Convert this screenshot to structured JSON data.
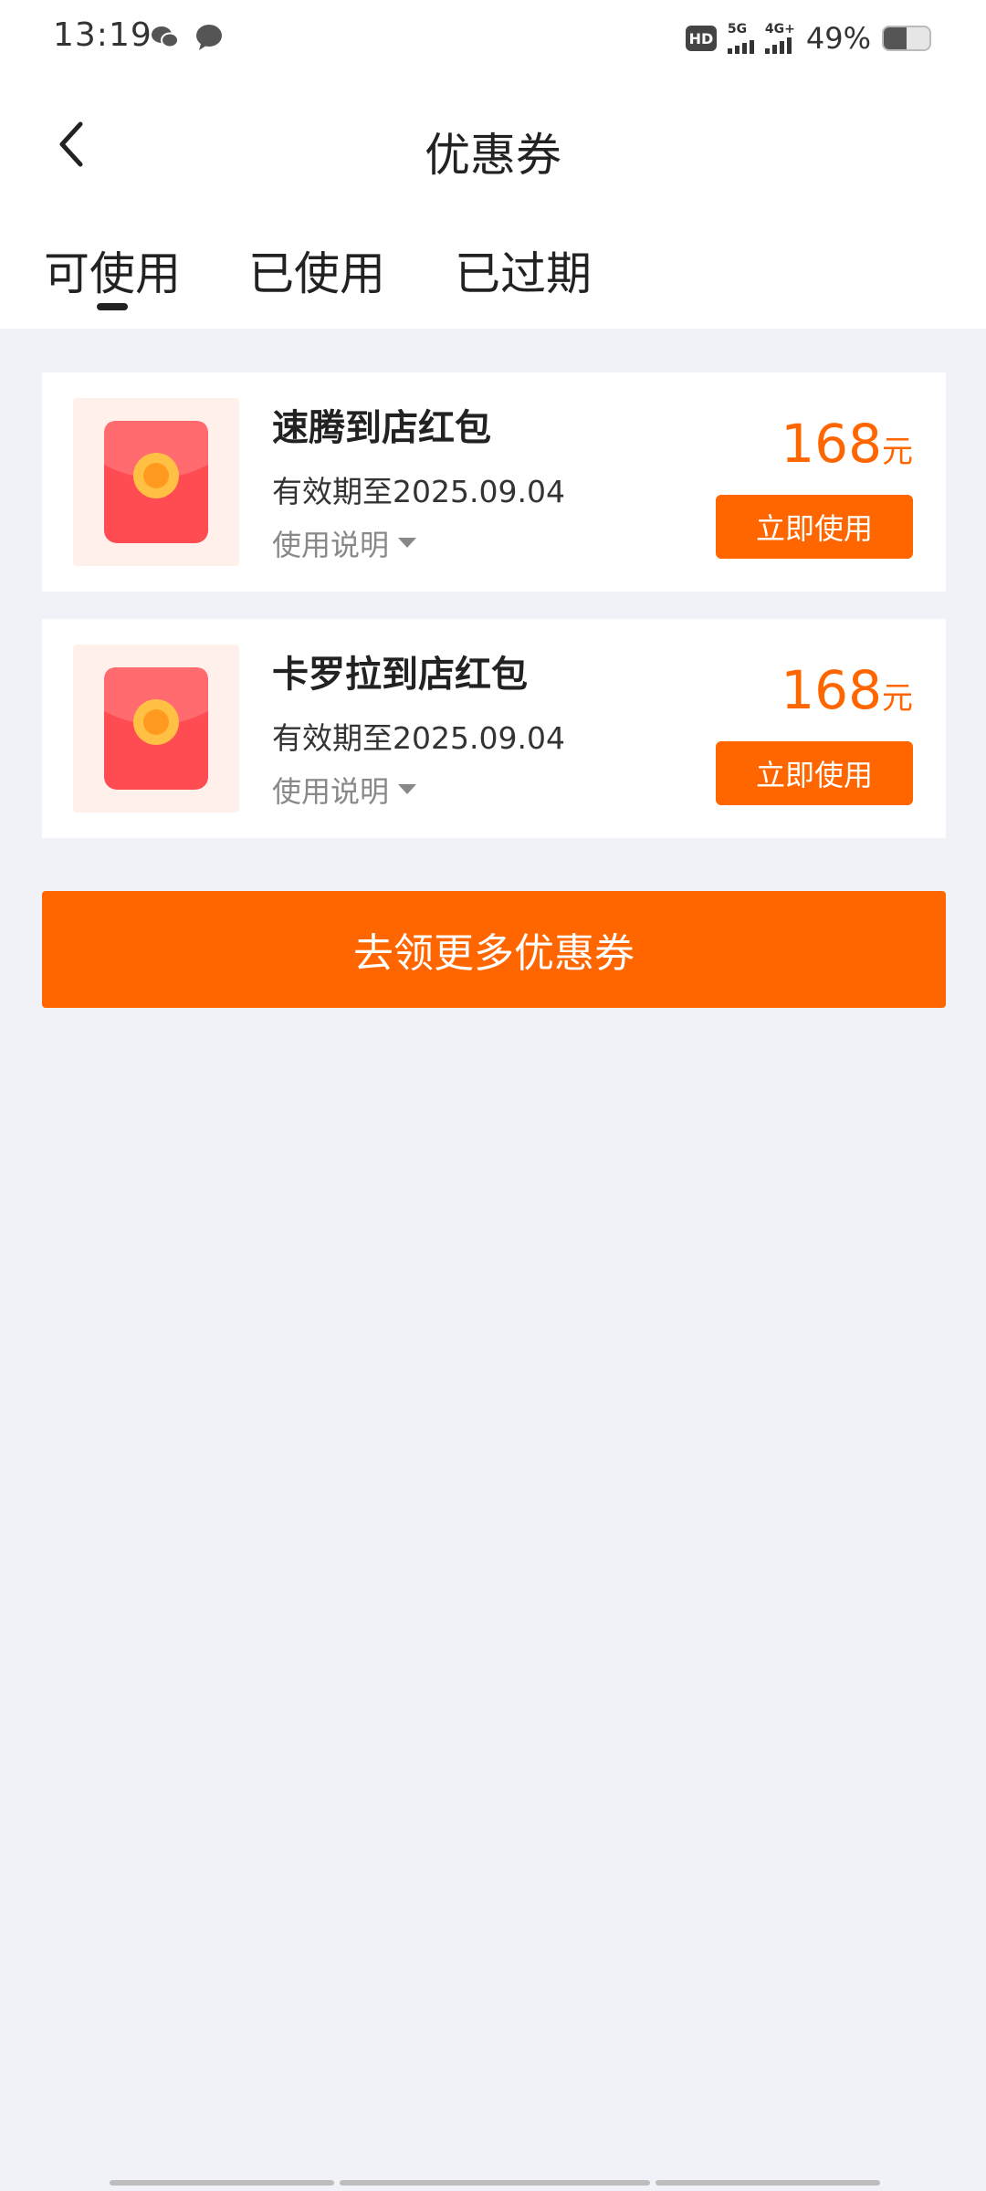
{
  "status_bar": {
    "time": "13:19",
    "hd_label": "HD",
    "signal_1_label": "5G",
    "signal_2_label": "4G+",
    "battery_percent": "49%",
    "battery_level": 0.49
  },
  "header": {
    "title": "优惠券"
  },
  "tabs": [
    {
      "label": "可使用",
      "active": true
    },
    {
      "label": "已使用",
      "active": false
    },
    {
      "label": "已过期",
      "active": false
    }
  ],
  "coupons": [
    {
      "name": "速腾到店红包",
      "expiry": "有效期至2025.09.04",
      "instructions": "使用说明",
      "amount": "168",
      "unit": "元",
      "button_label": "立即使用"
    },
    {
      "name": "卡罗拉到店红包",
      "expiry": "有效期至2025.09.04",
      "instructions": "使用说明",
      "amount": "168",
      "unit": "元",
      "button_label": "立即使用"
    }
  ],
  "more_button_label": "去领更多优惠券",
  "colors": {
    "accent": "#ff6600",
    "background": "#f1f2f7",
    "text_dark": "#222222",
    "text_muted": "#888888"
  }
}
